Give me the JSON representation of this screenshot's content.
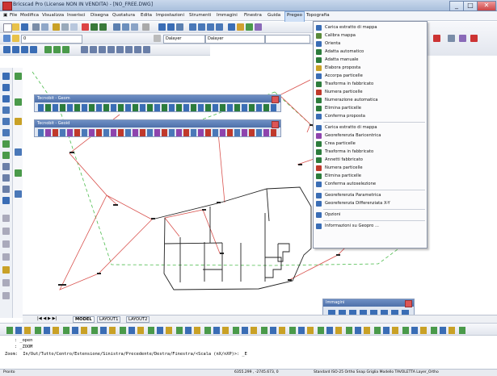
{
  "window": {
    "title": "Bricscad Pro (License NON IN VENDITA) - [NO_FREE.DWG]",
    "min": "_",
    "max": "□",
    "close": "✕"
  },
  "menu": {
    "items": [
      "File",
      "Modifica",
      "Visualizza",
      "Inserisci",
      "Disegna",
      "Quotatura",
      "Edita",
      "Impostazioni",
      "Strumenti",
      "Immagini",
      "Finestra",
      "Guida",
      "Pregeo",
      "Topografia"
    ],
    "active": "Pregeo"
  },
  "toolbar2": {
    "layer_value": "0",
    "linetype_value": "Dalayer",
    "lineweight_value": "Dalayer"
  },
  "panels": {
    "geom_title": "Tecnobit - Geom",
    "geom2_title": "Tecnobit - Geoid",
    "immagini_title": "Immagini"
  },
  "dropdown": {
    "items": [
      {
        "label": "Carica estratto di mappa",
        "icon_color": "#3a6db5",
        "sep_after": false
      },
      {
        "label": "Calibra mappa",
        "icon_color": "#5a8a3a",
        "sep_after": false
      },
      {
        "label": "Orienta",
        "icon_color": "#3a6db5",
        "sep_after": false
      },
      {
        "label": "Adatta automatico",
        "icon_color": "#2c7c3c",
        "sep_after": false
      },
      {
        "label": "Adatta manuale",
        "icon_color": "#2c7c3c",
        "sep_after": false
      },
      {
        "label": "Elabora proposta",
        "icon_color": "#c9a126",
        "sep_after": false
      },
      {
        "label": "Accorpa particelle",
        "icon_color": "#3a6db5",
        "sep_after": false
      },
      {
        "label": "Trasforma in fabbricato",
        "icon_color": "#2c7c3c",
        "sep_after": false
      },
      {
        "label": "Numera particelle",
        "icon_color": "#c0392b",
        "sep_after": false
      },
      {
        "label": "Numerazione automatica",
        "icon_color": "#2c7c3c",
        "sep_after": false
      },
      {
        "label": "Elimina particelle",
        "icon_color": "#2c7c3c",
        "sep_after": false
      },
      {
        "label": "Conferma proposta",
        "icon_color": "#3a6db5",
        "sep_after": true
      },
      {
        "label": "Carica estratto di mappa",
        "icon_color": "#3a6db5",
        "sep_after": false
      },
      {
        "label": "Georeferenzia Baricentrica",
        "icon_color": "#8e44ad",
        "sep_after": false
      },
      {
        "label": "Crea particelle",
        "icon_color": "#2c7c3c",
        "sep_after": false
      },
      {
        "label": "Trasforma in fabbricato",
        "icon_color": "#2c7c3c",
        "sep_after": false
      },
      {
        "label": "Annetti fabbricato",
        "icon_color": "#2c7c3c",
        "sep_after": false
      },
      {
        "label": "Numera particelle",
        "icon_color": "#c0392b",
        "sep_after": false
      },
      {
        "label": "Elimina particelle",
        "icon_color": "#2c7c3c",
        "sep_after": false
      },
      {
        "label": "Conferma autoselezione",
        "icon_color": "#3a6db5",
        "sep_after": true
      },
      {
        "label": "Georeferenzia Parametrica",
        "icon_color": "#3a6db5",
        "sep_after": false
      },
      {
        "label": "Georeferenzia Differenziata X-Y",
        "icon_color": "#3a6db5",
        "sep_after": true
      },
      {
        "label": "Opzioni",
        "icon_color": "#3a6db5",
        "sep_after": true
      },
      {
        "label": "Informazioni su Geopro ...",
        "icon_color": "#3a6db5",
        "sep_after": false
      }
    ]
  },
  "tabs": {
    "nav": "|◀ ◀ ▶ ▶|",
    "model": "MODEL",
    "layout1": "LAYOUT1",
    "layout2": "LAYOUT2"
  },
  "command": {
    "line1": ": _open",
    "line2": ": _ZOOM",
    "line3": "Zoom:  In/Out/Tutto/Centro/Estensione/Sinistra/Precedente/Destra/Finestra/<Scala (nX/nXP)>: _E"
  },
  "status": {
    "left": "Pronto",
    "coords": "6355.299 , -2745.673, 0",
    "right": "Standard  ISO-25    Ortho  Snap  Griglia  Modello  TAVOLETTA  Layer_Ortho"
  },
  "colors": {
    "accent": "#4e70aa",
    "red_lines": "#d9534f",
    "green_dashed": "#4cbb4c"
  }
}
